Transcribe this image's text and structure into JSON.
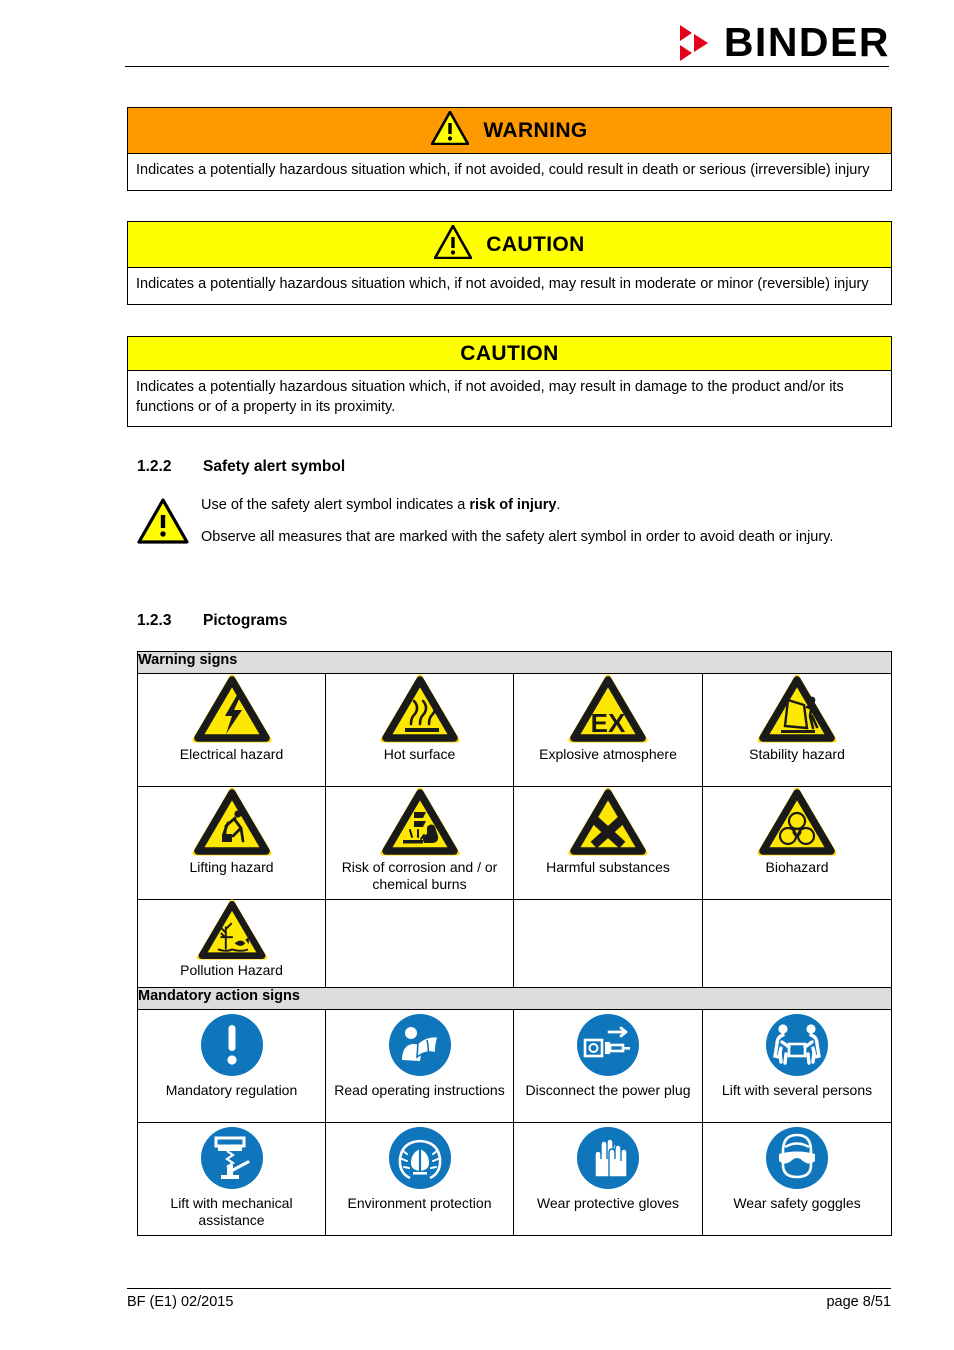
{
  "header": {
    "brand": "BINDER",
    "logo_icon": "binder-triangles-logo"
  },
  "alerts": [
    {
      "id": "warning",
      "title": "WARNING",
      "header_color": "#ff9900",
      "has_icon": true,
      "icon": "warning-triangle-icon",
      "body": "Indicates a potentially hazardous situation which, if not avoided, could result in death or serious (irreversible) injury"
    },
    {
      "id": "caution-injury",
      "title": "CAUTION",
      "header_color": "#ffff00",
      "has_icon": true,
      "icon": "warning-triangle-icon",
      "body": "Indicates a potentially hazardous situation which, if not avoided, may result in moderate or minor (reversible) injury"
    },
    {
      "id": "caution-product",
      "title": "CAUTION",
      "header_color": "#ffff00",
      "has_icon": false,
      "icon": "",
      "body": "Indicates a potentially hazardous situation which, if not avoided, may result in damage to the product and/or its functions or of a property in its proximity."
    }
  ],
  "sections": {
    "safety_alert": {
      "number": "1.2.2",
      "title": "Safety alert symbol",
      "icon": "safety-alert-triangle-icon",
      "paragraph1_prefix": "Use of the safety alert symbol indicates a ",
      "paragraph1_bold": "risk of injury",
      "paragraph1_suffix": ".",
      "paragraph2": "Observe all measures that are marked with the safety alert symbol in order to avoid death or injury."
    },
    "pictograms": {
      "number": "1.2.3",
      "title": "Pictograms"
    }
  },
  "pictogram_table": {
    "groups": [
      {
        "heading": "Warning signs",
        "rows": [
          [
            {
              "label": "Electrical hazard",
              "icon": "electrical-hazard-icon"
            },
            {
              "label": "Hot surface",
              "icon": "hot-surface-icon"
            },
            {
              "label": "Explosive atmosphere",
              "icon": "explosive-atmosphere-ex-icon"
            },
            {
              "label": "Stability hazard",
              "icon": "stability-hazard-icon"
            }
          ],
          [
            {
              "label": "Lifting hazard",
              "icon": "lifting-hazard-icon"
            },
            {
              "label": "Risk of corrosion and / or chemical burns",
              "icon": "corrosion-hazard-icon"
            },
            {
              "label": "Harmful substances",
              "icon": "harmful-substances-icon"
            },
            {
              "label": "Biohazard",
              "icon": "biohazard-icon"
            }
          ],
          [
            {
              "label": "Pollution Hazard",
              "icon": "pollution-hazard-icon"
            },
            {
              "label": "",
              "icon": ""
            },
            {
              "label": "",
              "icon": ""
            },
            {
              "label": "",
              "icon": ""
            }
          ]
        ]
      },
      {
        "heading": "Mandatory action signs",
        "rows": [
          [
            {
              "label": "Mandatory regulation",
              "icon": "mandatory-regulation-icon"
            },
            {
              "label": "Read operating instructions",
              "icon": "read-operating-instructions-icon"
            },
            {
              "label": "Disconnect the power plug",
              "icon": "disconnect-power-plug-icon"
            },
            {
              "label": "Lift with several persons",
              "icon": "lift-several-persons-icon"
            }
          ],
          [
            {
              "label": "Lift with mechanical assistance",
              "icon": "lift-mechanical-assistance-icon"
            },
            {
              "label": "Environment protection",
              "icon": "environment-protection-icon"
            },
            {
              "label": "Wear protective gloves",
              "icon": "wear-protective-gloves-icon"
            },
            {
              "label": "Wear safety goggles",
              "icon": "wear-safety-goggles-icon"
            }
          ]
        ]
      }
    ]
  },
  "footer": {
    "left": "BF (E1) 02/2015",
    "right": "page 8/51"
  },
  "colors": {
    "warning_orange": "#ff9900",
    "caution_yellow": "#ffff00",
    "mandatory_blue": "#0f76bc",
    "table_header_gray": "#dcdcdc",
    "logo_red": "#e2001a"
  }
}
